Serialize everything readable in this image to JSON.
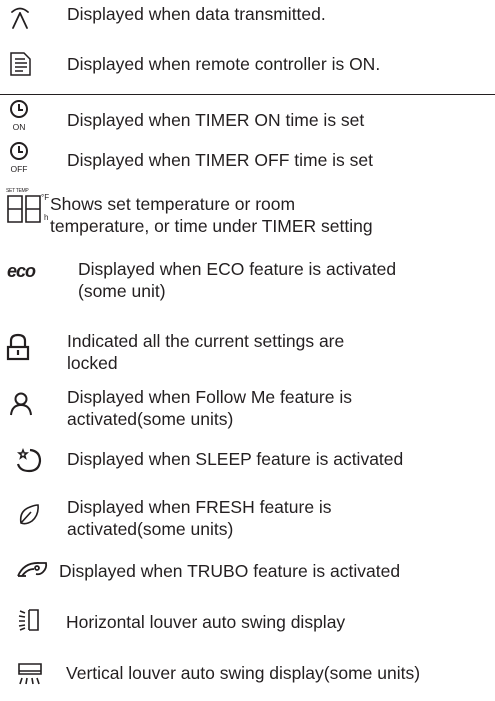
{
  "rows": [
    {
      "icon": "transmit-icon",
      "text": "Displayed when data transmitted."
    },
    {
      "icon": "remote-on-icon",
      "text": "Displayed when remote controller is ON."
    },
    {
      "icon": "timer-on-icon",
      "sub": "ON",
      "text": "Displayed when TIMER ON time is set"
    },
    {
      "icon": "timer-off-icon",
      "sub": "OFF",
      "text": "Displayed when TIMER OFF time is set"
    },
    {
      "icon": "temperature-display-icon",
      "icon_texts": [
        "SET TEMP",
        "°F",
        "h"
      ],
      "lines": [
        "Shows set temperature or room",
        "temperature, or time under TIMER setting"
      ]
    },
    {
      "icon": "eco-icon",
      "icon_text": "eco",
      "lines": [
        "Displayed when ECO feature is activated",
        "(some unit)"
      ]
    },
    {
      "icon": "lock-icon",
      "lines": [
        "Indicated all the current settings are",
        "locked"
      ]
    },
    {
      "icon": "follow-me-icon",
      "lines": [
        "Displayed when Follow Me feature is",
        "activated(some units)"
      ]
    },
    {
      "icon": "sleep-icon",
      "text": "Displayed when SLEEP feature is activated"
    },
    {
      "icon": "fresh-icon",
      "lines": [
        "Displayed when FRESH feature is",
        "activated(some units)"
      ]
    },
    {
      "icon": "turbo-icon",
      "text": "Displayed when TRUBO feature is activated"
    },
    {
      "icon": "horizontal-swing-icon",
      "text": "Horizontal louver auto swing display"
    },
    {
      "icon": "vertical-swing-icon",
      "text": "Vertical louver auto swing display(some units)"
    }
  ]
}
